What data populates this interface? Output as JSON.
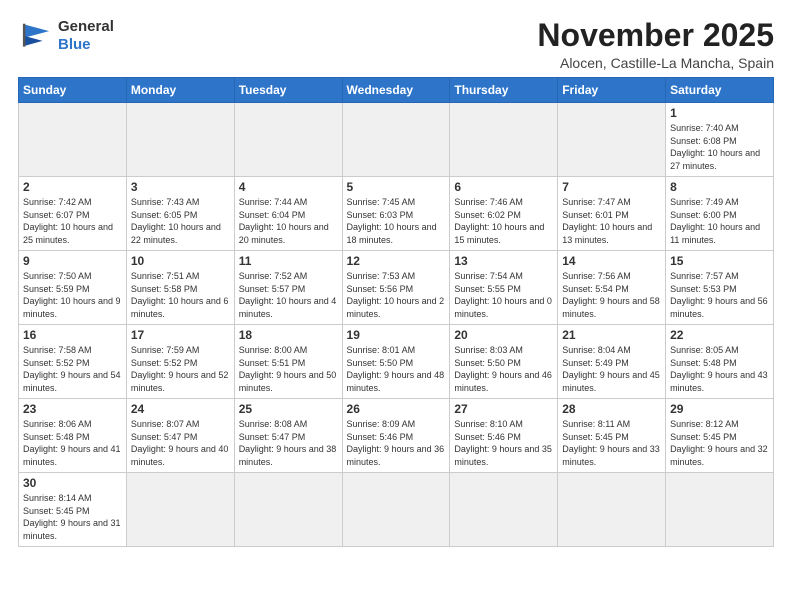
{
  "header": {
    "logo_line1": "General",
    "logo_line2": "Blue",
    "month": "November 2025",
    "location": "Alocen, Castille-La Mancha, Spain"
  },
  "weekdays": [
    "Sunday",
    "Monday",
    "Tuesday",
    "Wednesday",
    "Thursday",
    "Friday",
    "Saturday"
  ],
  "weeks": [
    [
      {
        "day": "",
        "empty": true
      },
      {
        "day": "",
        "empty": true
      },
      {
        "day": "",
        "empty": true
      },
      {
        "day": "",
        "empty": true
      },
      {
        "day": "",
        "empty": true
      },
      {
        "day": "",
        "empty": true
      },
      {
        "day": "1",
        "info": "Sunrise: 7:40 AM\nSunset: 6:08 PM\nDaylight: 10 hours\nand 27 minutes."
      }
    ],
    [
      {
        "day": "2",
        "info": "Sunrise: 7:42 AM\nSunset: 6:07 PM\nDaylight: 10 hours\nand 25 minutes."
      },
      {
        "day": "3",
        "info": "Sunrise: 7:43 AM\nSunset: 6:05 PM\nDaylight: 10 hours\nand 22 minutes."
      },
      {
        "day": "4",
        "info": "Sunrise: 7:44 AM\nSunset: 6:04 PM\nDaylight: 10 hours\nand 20 minutes."
      },
      {
        "day": "5",
        "info": "Sunrise: 7:45 AM\nSunset: 6:03 PM\nDaylight: 10 hours\nand 18 minutes."
      },
      {
        "day": "6",
        "info": "Sunrise: 7:46 AM\nSunset: 6:02 PM\nDaylight: 10 hours\nand 15 minutes."
      },
      {
        "day": "7",
        "info": "Sunrise: 7:47 AM\nSunset: 6:01 PM\nDaylight: 10 hours\nand 13 minutes."
      },
      {
        "day": "8",
        "info": "Sunrise: 7:49 AM\nSunset: 6:00 PM\nDaylight: 10 hours\nand 11 minutes."
      }
    ],
    [
      {
        "day": "9",
        "info": "Sunrise: 7:50 AM\nSunset: 5:59 PM\nDaylight: 10 hours\nand 9 minutes."
      },
      {
        "day": "10",
        "info": "Sunrise: 7:51 AM\nSunset: 5:58 PM\nDaylight: 10 hours\nand 6 minutes."
      },
      {
        "day": "11",
        "info": "Sunrise: 7:52 AM\nSunset: 5:57 PM\nDaylight: 10 hours\nand 4 minutes."
      },
      {
        "day": "12",
        "info": "Sunrise: 7:53 AM\nSunset: 5:56 PM\nDaylight: 10 hours\nand 2 minutes."
      },
      {
        "day": "13",
        "info": "Sunrise: 7:54 AM\nSunset: 5:55 PM\nDaylight: 10 hours\nand 0 minutes."
      },
      {
        "day": "14",
        "info": "Sunrise: 7:56 AM\nSunset: 5:54 PM\nDaylight: 9 hours\nand 58 minutes."
      },
      {
        "day": "15",
        "info": "Sunrise: 7:57 AM\nSunset: 5:53 PM\nDaylight: 9 hours\nand 56 minutes."
      }
    ],
    [
      {
        "day": "16",
        "info": "Sunrise: 7:58 AM\nSunset: 5:52 PM\nDaylight: 9 hours\nand 54 minutes."
      },
      {
        "day": "17",
        "info": "Sunrise: 7:59 AM\nSunset: 5:52 PM\nDaylight: 9 hours\nand 52 minutes."
      },
      {
        "day": "18",
        "info": "Sunrise: 8:00 AM\nSunset: 5:51 PM\nDaylight: 9 hours\nand 50 minutes."
      },
      {
        "day": "19",
        "info": "Sunrise: 8:01 AM\nSunset: 5:50 PM\nDaylight: 9 hours\nand 48 minutes."
      },
      {
        "day": "20",
        "info": "Sunrise: 8:03 AM\nSunset: 5:50 PM\nDaylight: 9 hours\nand 46 minutes."
      },
      {
        "day": "21",
        "info": "Sunrise: 8:04 AM\nSunset: 5:49 PM\nDaylight: 9 hours\nand 45 minutes."
      },
      {
        "day": "22",
        "info": "Sunrise: 8:05 AM\nSunset: 5:48 PM\nDaylight: 9 hours\nand 43 minutes."
      }
    ],
    [
      {
        "day": "23",
        "info": "Sunrise: 8:06 AM\nSunset: 5:48 PM\nDaylight: 9 hours\nand 41 minutes."
      },
      {
        "day": "24",
        "info": "Sunrise: 8:07 AM\nSunset: 5:47 PM\nDaylight: 9 hours\nand 40 minutes."
      },
      {
        "day": "25",
        "info": "Sunrise: 8:08 AM\nSunset: 5:47 PM\nDaylight: 9 hours\nand 38 minutes."
      },
      {
        "day": "26",
        "info": "Sunrise: 8:09 AM\nSunset: 5:46 PM\nDaylight: 9 hours\nand 36 minutes."
      },
      {
        "day": "27",
        "info": "Sunrise: 8:10 AM\nSunset: 5:46 PM\nDaylight: 9 hours\nand 35 minutes."
      },
      {
        "day": "28",
        "info": "Sunrise: 8:11 AM\nSunset: 5:45 PM\nDaylight: 9 hours\nand 33 minutes."
      },
      {
        "day": "29",
        "info": "Sunrise: 8:12 AM\nSunset: 5:45 PM\nDaylight: 9 hours\nand 32 minutes."
      }
    ],
    [
      {
        "day": "30",
        "info": "Sunrise: 8:14 AM\nSunset: 5:45 PM\nDaylight: 9 hours\nand 31 minutes."
      },
      {
        "day": "",
        "empty": true
      },
      {
        "day": "",
        "empty": true
      },
      {
        "day": "",
        "empty": true
      },
      {
        "day": "",
        "empty": true
      },
      {
        "day": "",
        "empty": true
      },
      {
        "day": "",
        "empty": true
      }
    ]
  ]
}
